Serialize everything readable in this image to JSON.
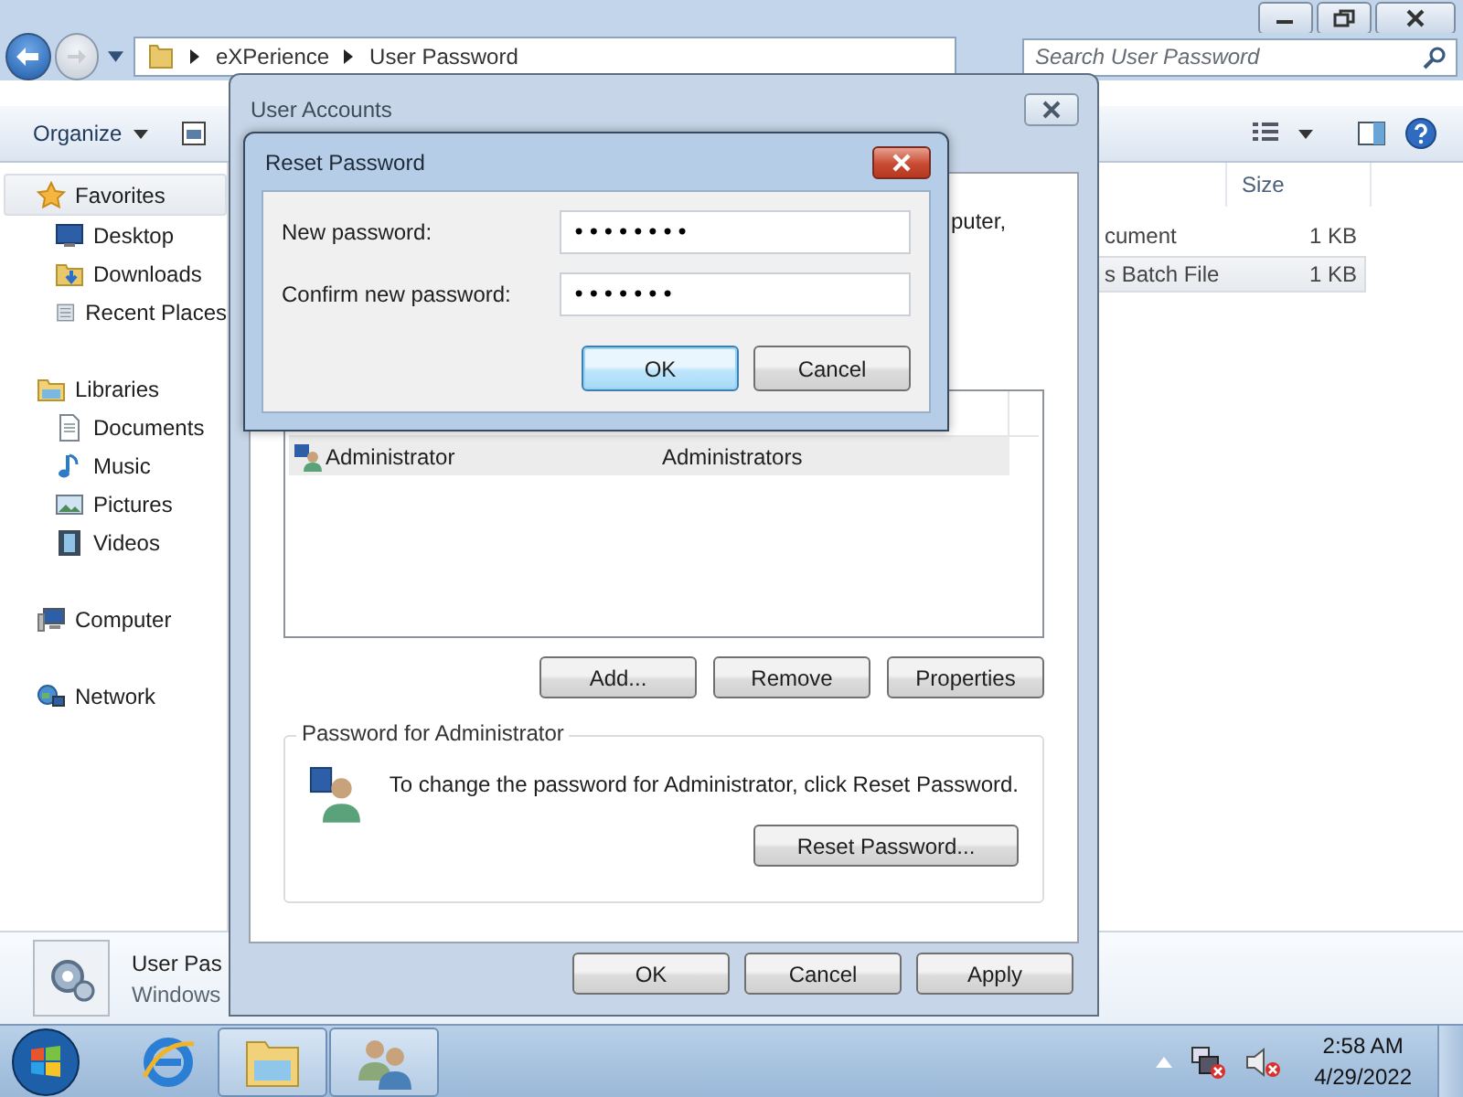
{
  "explorer": {
    "breadcrumb": [
      "eXPerience",
      "User Password"
    ],
    "search": {
      "placeholder": "Search User Password"
    },
    "toolbar": {
      "organize": "Organize"
    },
    "nav": [
      {
        "label": "Favorites",
        "kind": "favorites",
        "selected": true,
        "children": [
          {
            "label": "Desktop",
            "kind": "desktop",
            "selected": false
          },
          {
            "label": "Downloads",
            "kind": "downloads",
            "selected": false
          },
          {
            "label": "Recent Places",
            "kind": "recent",
            "selected": false
          }
        ]
      },
      {
        "label": "Libraries",
        "kind": "libraries",
        "selected": false,
        "children": [
          {
            "label": "Documents",
            "kind": "documents",
            "selected": false
          },
          {
            "label": "Music",
            "kind": "music",
            "selected": false
          },
          {
            "label": "Pictures",
            "kind": "pictures",
            "selected": false
          },
          {
            "label": "Videos",
            "kind": "videos",
            "selected": false
          }
        ]
      },
      {
        "label": "Computer",
        "kind": "computer",
        "selected": false
      },
      {
        "label": "Network",
        "kind": "network",
        "selected": false
      }
    ],
    "columns": [
      "Size"
    ],
    "files": [
      {
        "name": "cument",
        "size": "1 KB",
        "selected": false
      },
      {
        "name": "s Batch File",
        "size": "1 KB",
        "selected": true
      }
    ],
    "details": {
      "name": "User Pas",
      "type": "Windows"
    }
  },
  "user_accounts": {
    "title": "User Accounts",
    "intro_fragment": "puter,",
    "users": [
      {
        "name": "Administrator",
        "group": "Administrators",
        "selected": true
      }
    ],
    "list_buttons": [
      "Add...",
      "Remove",
      "Properties"
    ],
    "password_group": {
      "legend": "Password for Administrator",
      "text": "To change the password for Administrator, click Reset Password.",
      "button": "Reset Password..."
    },
    "buttons": [
      "OK",
      "Cancel",
      "Apply"
    ]
  },
  "reset_dialog": {
    "title": "Reset Password",
    "fields": [
      {
        "label": "New password:",
        "value": "••••••••"
      },
      {
        "label": "Confirm new password:",
        "value": "•••••••"
      }
    ],
    "buttons": [
      {
        "label": "OK",
        "default": true
      },
      {
        "label": "Cancel",
        "default": false
      }
    ]
  },
  "taskbar": {
    "time": "2:58 AM",
    "date": "4/29/2022"
  }
}
